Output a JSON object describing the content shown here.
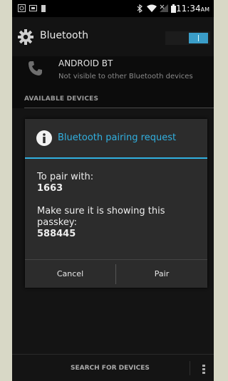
{
  "status_bar": {
    "time": "11:34",
    "ampm": "AM",
    "left_icons": [
      "screenshot-icon",
      "sd-card-icon",
      "battery-small-icon"
    ],
    "right_icons": [
      "bluetooth-icon",
      "wifi-icon",
      "no-signal-icon",
      "battery-icon"
    ]
  },
  "action_bar": {
    "title": "Bluetooth",
    "toggle_on": true
  },
  "device": {
    "name": "ANDROID BT",
    "subtitle": "Not visible to other Bluetooth devices"
  },
  "section": {
    "header": "AVAILABLE DEVICES"
  },
  "dialog": {
    "title": "Bluetooth pairing request",
    "pair_with_label": "To pair with:",
    "device_code": "1663",
    "instruction_line1": "Make sure it is showing this",
    "instruction_line2": "passkey:",
    "passkey": "588445",
    "cancel_label": "Cancel",
    "pair_label": "Pair"
  },
  "bottom_bar": {
    "search_label": "SEARCH FOR DEVICES"
  }
}
